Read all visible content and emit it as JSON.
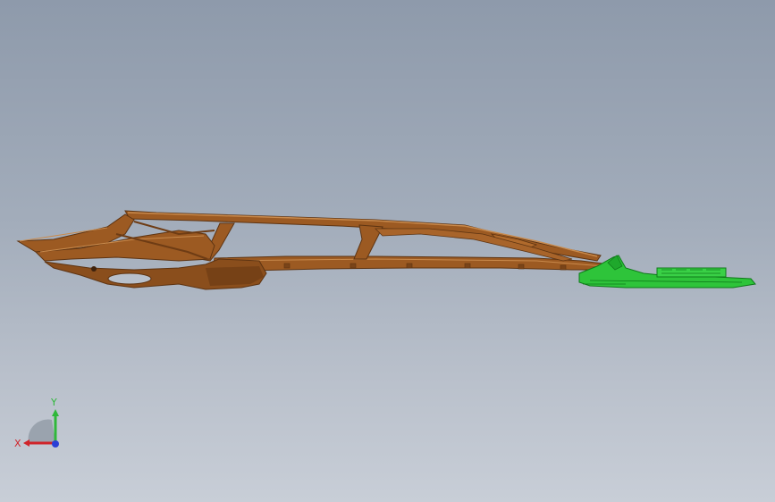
{
  "viewport": {
    "background_top": "#8e9aab",
    "background_bottom": "#c8ced7"
  },
  "model": {
    "main_part_color": "#9c5a22",
    "main_part_highlight": "#c98a4c",
    "main_part_shadow": "#5e3412",
    "secondary_part_color": "#2ec43a",
    "secondary_part_shadow": "#0f7a1a"
  },
  "triad": {
    "x_label": "X",
    "y_label": "Y",
    "x_color": "#d0242a",
    "y_color": "#2fb83a",
    "z_color": "#2a3fd6"
  }
}
